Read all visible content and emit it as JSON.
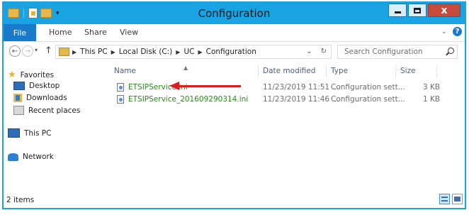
{
  "window": {
    "title": "Configuration",
    "close_glyph": "x"
  },
  "ribbon": {
    "tabs": [
      "File",
      "Home",
      "Share",
      "View"
    ]
  },
  "address": {
    "breadcrumbs": [
      "This PC",
      "Local Disk (C:)",
      "UC",
      "Configuration"
    ],
    "dropdown_glyph": "⌄",
    "refresh_glyph": "↻"
  },
  "search": {
    "placeholder": "Search Configuration"
  },
  "navigation": {
    "favorites_label": "Favorites",
    "favorites_items": [
      "Desktop",
      "Downloads",
      "Recent places"
    ],
    "this_pc_label": "This PC",
    "network_label": "Network"
  },
  "columns": [
    "Name",
    "Date modified",
    "Type",
    "Size"
  ],
  "files": [
    {
      "name": "ETSIPService.ini",
      "date_modified": "11/23/2019 11:51 ...",
      "type": "Configuration sett...",
      "size": "3 KB"
    },
    {
      "name": "ETSIPService_201609290314.ini",
      "date_modified": "11/23/2019 11:46 ...",
      "type": "Configuration sett...",
      "size": "1 KB"
    }
  ],
  "status": {
    "item_count": "2 items"
  },
  "colors": {
    "titlebar": "#19a3e2",
    "file_tab": "#1979ca",
    "file_name_text": "#2a8a1a",
    "annotation_arrow": "#d81e1e"
  }
}
